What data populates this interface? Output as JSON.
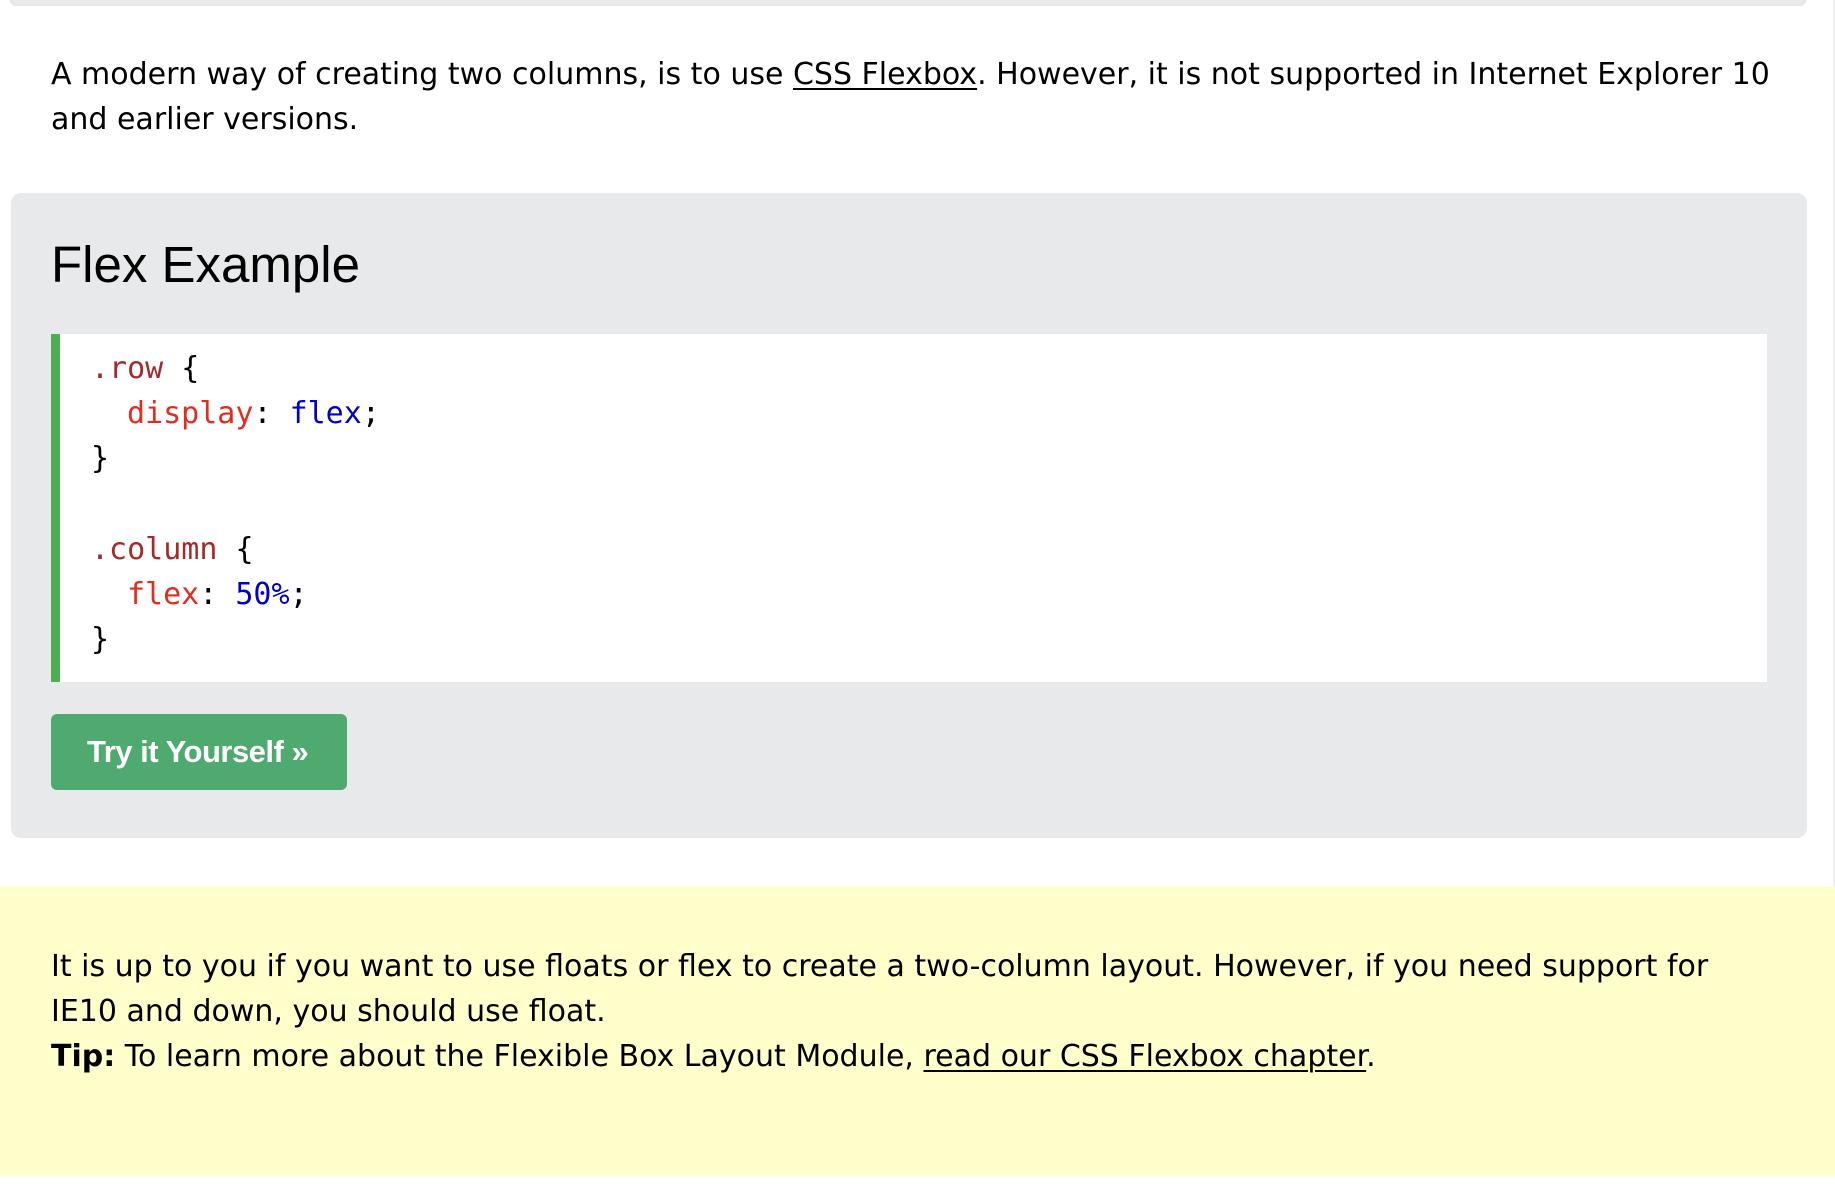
{
  "intro": {
    "text_before": "A modern way of creating two columns, is to use ",
    "link": "CSS Flexbox",
    "text_after": ". However, it is not supported in Internet Explorer 10 and earlier versions."
  },
  "example": {
    "title": "Flex Example",
    "code": {
      "row_selector": ".row",
      "row_open": " {",
      "row_prop": "display",
      "row_colon": ": ",
      "row_value": "flex",
      "row_semicolon": ";",
      "row_close": "}",
      "column_selector": ".column",
      "column_open": " {",
      "column_prop": "flex",
      "column_colon": ": ",
      "column_value": "50%",
      "column_semicolon": ";",
      "column_close": "}"
    },
    "button_label": "Try it Yourself »"
  },
  "note": {
    "text": "It is up to you if you want to use floats or flex to create a two-column layout. However, if you need support for IE10 and down, you should use float.",
    "tip_label": "Tip:",
    "tip_text": " To learn more about the Flexible Box Layout Module, ",
    "tip_link": "read our CSS Flexbox chapter",
    "tip_end": "."
  },
  "colors": {
    "panel_background": "#e7e9eb",
    "code_border": "#4caf50",
    "button_background": "#4eaa6f",
    "note_background": "#ffffcc",
    "selector_color": "#a52a2a",
    "property_color": "#e12d1f",
    "value_color": "#0000cd"
  }
}
